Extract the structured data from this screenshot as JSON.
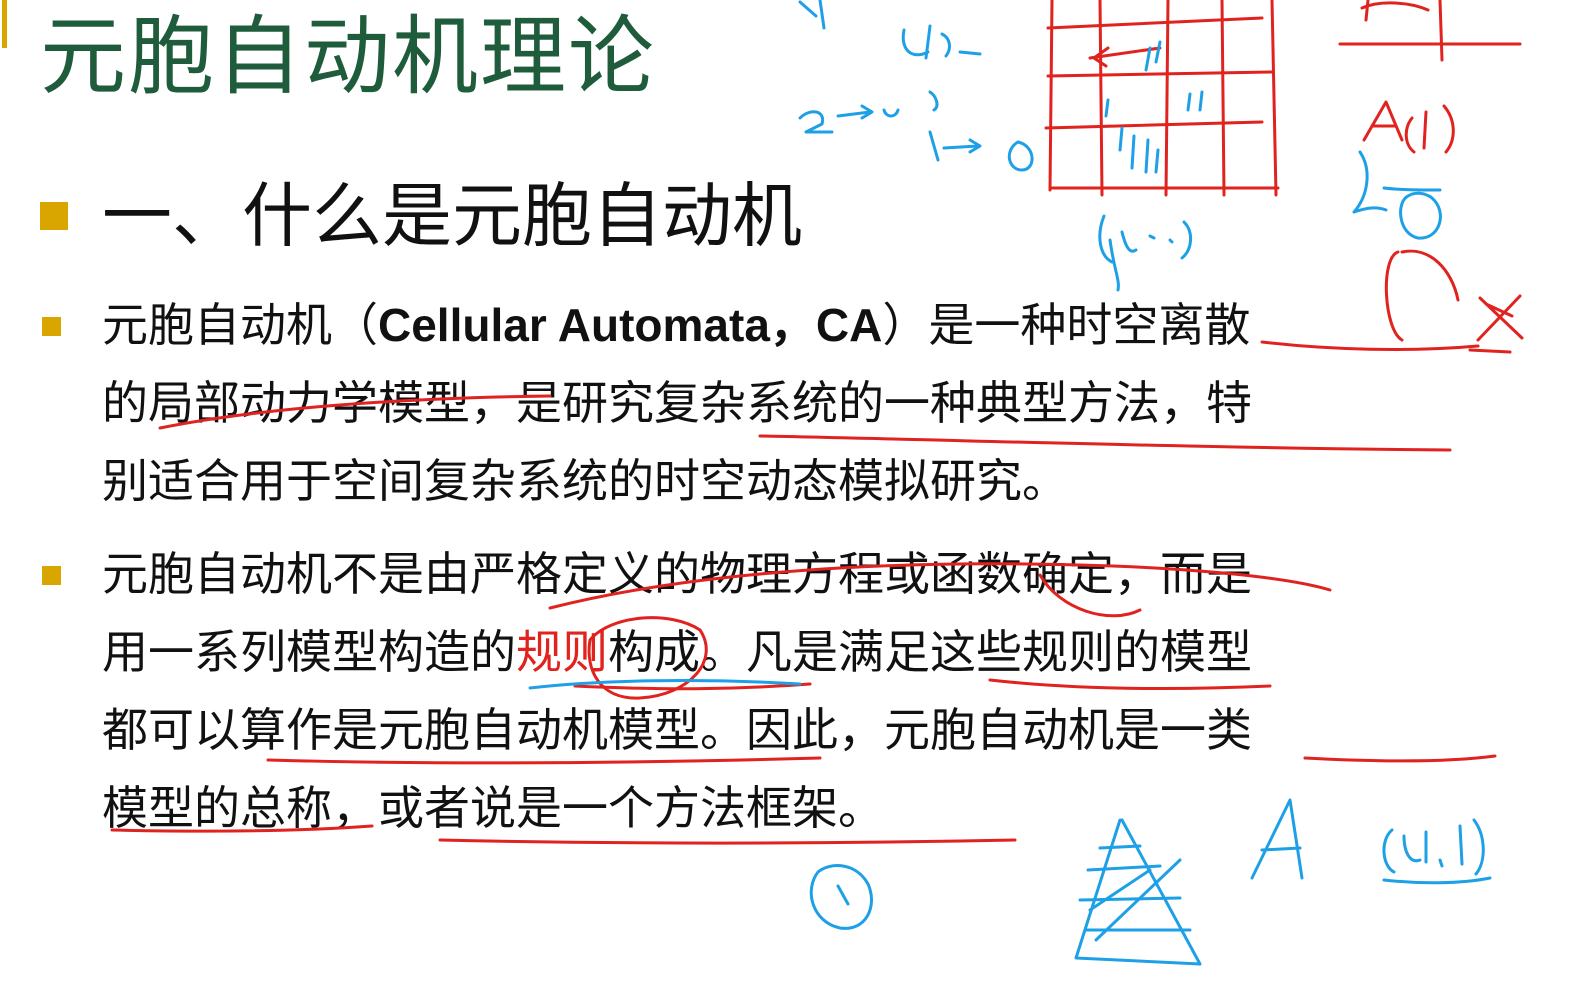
{
  "slide": {
    "title": "元胞自动机理论",
    "section_heading": "一、什么是元胞自动机",
    "paragraph1": {
      "line1_a": "元胞自动机（",
      "line1_b": "Cellular Automata，CA",
      "line1_c": "）是一种时空离散",
      "line2": "的局部动力学模型，是研究复杂系统的一种典型方法，特",
      "line3": "别适合用于空间复杂系统的时空动态模拟研究。"
    },
    "paragraph2": {
      "line1": "元胞自动机不是由严格定义的物理方程或函数确定，而是",
      "line2_a": "用一系列模型构造的",
      "line2_b": "规则",
      "line2_c": "构成。凡是满足这些规则的模型",
      "line3": "都可以算作是元胞自动机模型。因此，元胞自动机是一类",
      "line4": "模型的总称，或者说是一个方法框架。"
    }
  },
  "handwriting": {
    "blue_notes": [
      "(i,j)",
      "2→2",
      "1→0",
      "(i,j)",
      "A",
      "(i,j)",
      "1"
    ],
    "red_notes": [
      "A(i,j)"
    ]
  },
  "colors": {
    "title_green": "#1f5c3b",
    "bullet_gold": "#d9a600",
    "ink_red": "#e0231f",
    "ink_blue": "#1ea0e6"
  }
}
